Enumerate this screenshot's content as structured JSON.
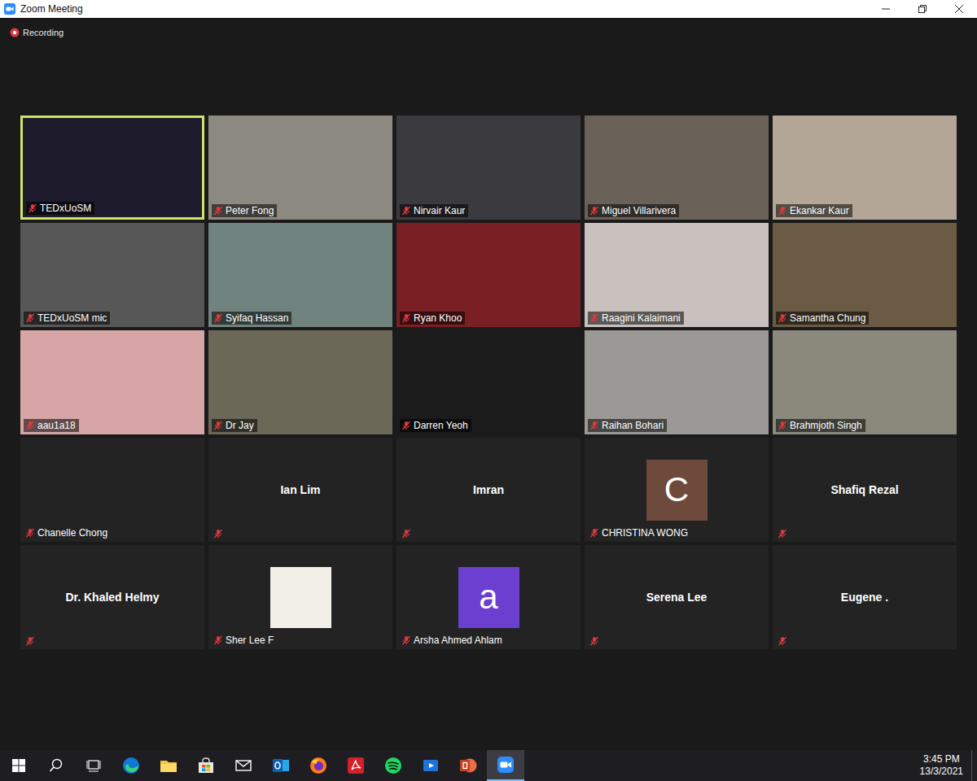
{
  "window": {
    "title": "Zoom Meeting"
  },
  "recording": {
    "label": "Recording",
    "on": true
  },
  "participants": [
    {
      "name": "TEDxUoSM",
      "kind": "video",
      "muted": true,
      "highlighted": true,
      "color": "#1d1b2c"
    },
    {
      "name": "Peter Fong",
      "kind": "video",
      "muted": true,
      "highlighted": false,
      "color": "#8c8a80"
    },
    {
      "name": "Nirvair Kaur",
      "kind": "video",
      "muted": true,
      "highlighted": false,
      "color": "#3b3a3e"
    },
    {
      "name": "Miguel Villarivera",
      "kind": "video",
      "muted": true,
      "highlighted": false,
      "color": "#6a6258"
    },
    {
      "name": "Ekankar Kaur",
      "kind": "video",
      "muted": true,
      "highlighted": false,
      "color": "#b4a696"
    },
    {
      "name": "TEDxUoSM mic",
      "kind": "video",
      "muted": true,
      "highlighted": false,
      "color": "#575757"
    },
    {
      "name": "Syifaq Hassan",
      "kind": "video",
      "muted": true,
      "highlighted": false,
      "color": "#71837f"
    },
    {
      "name": "Ryan Khoo",
      "kind": "video",
      "muted": true,
      "highlighted": false,
      "color": "#7a1f24"
    },
    {
      "name": "Raagini Kalaimani",
      "kind": "video",
      "muted": true,
      "highlighted": false,
      "color": "#c8c1bd"
    },
    {
      "name": "Samantha Chung",
      "kind": "video",
      "muted": true,
      "highlighted": false,
      "color": "#6b5a44"
    },
    {
      "name": "aau1a18",
      "kind": "video",
      "muted": true,
      "highlighted": false,
      "color": "#d7a5a6"
    },
    {
      "name": "Dr Jay",
      "kind": "video",
      "muted": true,
      "highlighted": false,
      "color": "#6c6858"
    },
    {
      "name": "Darren Yeoh",
      "kind": "video",
      "muted": true,
      "highlighted": false,
      "color": "#1b1b1b"
    },
    {
      "name": "Raihan Bohari",
      "kind": "video",
      "muted": true,
      "highlighted": false,
      "color": "#9a9995"
    },
    {
      "name": "Brahmjoth Singh",
      "kind": "video",
      "muted": true,
      "highlighted": false,
      "color": "#8a897c"
    },
    {
      "name": "Chanelle Chong",
      "kind": "blank",
      "muted": true,
      "highlighted": false
    },
    {
      "name": "Ian Lim",
      "kind": "name",
      "muted": true,
      "highlighted": false
    },
    {
      "name": "Imran",
      "kind": "name",
      "muted": true,
      "highlighted": false
    },
    {
      "name": "CHRISTINA WONG",
      "kind": "avatar",
      "avatar": "C",
      "muted": true,
      "highlighted": false,
      "color": "#6e4a3c"
    },
    {
      "name": "Shafiq Rezal",
      "kind": "name",
      "muted": true,
      "highlighted": false
    },
    {
      "name": "Dr. Khaled Helmy",
      "kind": "name",
      "muted": true,
      "highlighted": false
    },
    {
      "name": "Sher Lee F",
      "kind": "picture",
      "muted": true,
      "highlighted": false
    },
    {
      "name": "Arsha Ahmed Ahlam",
      "kind": "avatar",
      "avatar": "a",
      "muted": true,
      "highlighted": false,
      "color": "#6b3fcf"
    },
    {
      "name": "Serena Lee",
      "kind": "name",
      "muted": true,
      "highlighted": false
    },
    {
      "name": "Eugene .",
      "kind": "name",
      "muted": true,
      "highlighted": false
    }
  ],
  "taskbar": {
    "apps": [
      {
        "kind": "start",
        "selected": false
      },
      {
        "kind": "search",
        "selected": false
      },
      {
        "kind": "taskview",
        "selected": false
      },
      {
        "kind": "edge",
        "selected": false
      },
      {
        "kind": "explorer",
        "selected": false
      },
      {
        "kind": "store",
        "selected": false
      },
      {
        "kind": "mail",
        "selected": false
      },
      {
        "kind": "outlook",
        "selected": false
      },
      {
        "kind": "firefox",
        "selected": false
      },
      {
        "kind": "acrobat",
        "selected": false
      },
      {
        "kind": "spotify",
        "selected": false
      },
      {
        "kind": "media",
        "selected": false
      },
      {
        "kind": "powerpoint",
        "selected": false
      },
      {
        "kind": "zoom",
        "selected": true
      }
    ],
    "clock": {
      "time": "3:45 PM",
      "date": "13/3/2021"
    }
  }
}
